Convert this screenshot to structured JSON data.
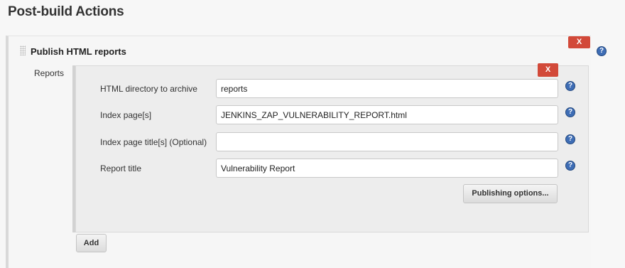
{
  "section": {
    "title": "Post-build Actions"
  },
  "step": {
    "title": "Publish HTML reports",
    "delete_label": "X",
    "help_symbol": "?"
  },
  "reports": {
    "label": "Reports",
    "delete_label": "X",
    "fields": [
      {
        "label": "HTML directory to archive",
        "value": "reports",
        "help_symbol": "?"
      },
      {
        "label": "Index page[s]",
        "value": "JENKINS_ZAP_VULNERABILITY_REPORT.html",
        "help_symbol": "?"
      },
      {
        "label": "Index page title[s] (Optional)",
        "value": "",
        "help_symbol": "?"
      },
      {
        "label": "Report title",
        "value": "Vulnerability Report",
        "help_symbol": "?"
      }
    ],
    "publishing_options_label": "Publishing options...",
    "add_label": "Add"
  },
  "colors": {
    "delete": "#d24939",
    "help": "#3e6db5",
    "page_bg": "#f7f7f7",
    "inner_panel_bg": "#ededed"
  },
  "icons": {
    "help": "help-icon",
    "delete": "delete-icon",
    "drag": "drag-handle-icon"
  }
}
